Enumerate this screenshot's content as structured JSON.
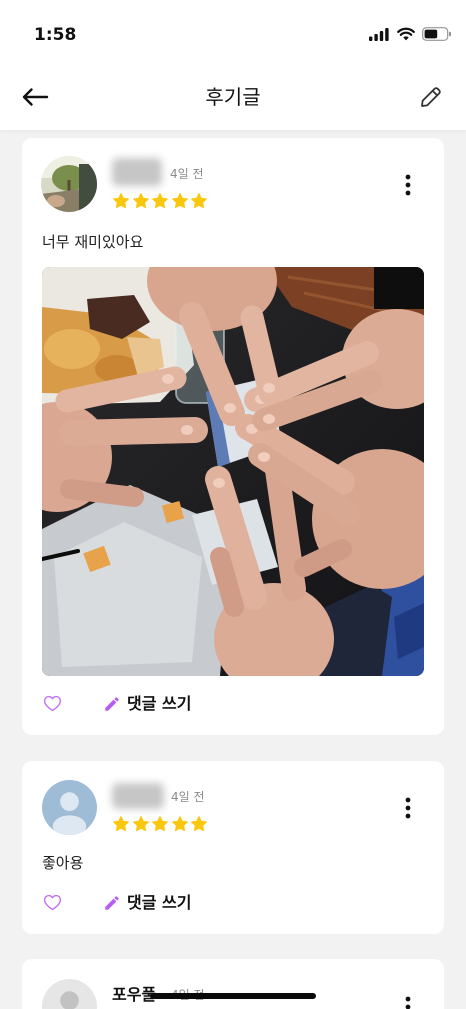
{
  "status_bar": {
    "time": "1:58",
    "battery_level": 0.6,
    "icons": [
      "signal-icon",
      "wifi-icon",
      "battery-icon"
    ]
  },
  "header": {
    "title": "후기글",
    "back_icon": "arrow-left-icon",
    "write_icon": "pencil-outline-icon"
  },
  "colors": {
    "background": "#f2f2f2",
    "text": "#1f1f1f",
    "muted": "#8b8b8b",
    "accent": "#b65ef2",
    "heart": "#c56ef0",
    "star": "#f9c80e"
  },
  "reviews": [
    {
      "time_ago": "4일 전",
      "rating": 5,
      "text": "너무 재미있아요",
      "menu_icon": "more-vertical-icon",
      "like_icon": "heart-outline-icon",
      "comment_icon": "pencil-icon",
      "comment_label": "댓글 쓰기"
    },
    {
      "time_ago": "4일 전",
      "rating": 5,
      "text": "좋아용",
      "avatar_icon": "default-user-icon",
      "menu_icon": "more-vertical-icon",
      "like_icon": "heart-outline-icon",
      "comment_icon": "pencil-icon",
      "comment_label": "댓글 쓰기"
    },
    {
      "author": "포우풀",
      "time_ago": "4일 전",
      "avatar_icon": "default-user-icon",
      "menu_icon": "more-vertical-icon"
    }
  ]
}
